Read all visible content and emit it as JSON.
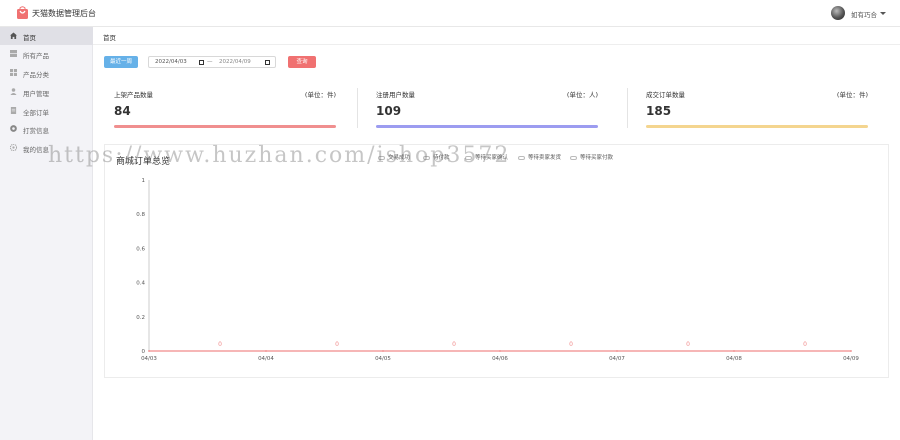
{
  "header": {
    "app_title": "天猫数据管理后台",
    "user_name": "如有巧合",
    "logo_icon": "shopping-bag-icon",
    "logo_color": "#f07171"
  },
  "sidebar": {
    "items": [
      {
        "label": "首页",
        "icon": "home-icon",
        "active": true
      },
      {
        "label": "所有产品",
        "icon": "grid-icon",
        "active": false
      },
      {
        "label": "产品分类",
        "icon": "category-icon",
        "active": false
      },
      {
        "label": "用户管理",
        "icon": "user-icon",
        "active": false
      },
      {
        "label": "全部订单",
        "icon": "order-icon",
        "active": false
      },
      {
        "label": "打赏信息",
        "icon": "reward-icon",
        "active": false
      },
      {
        "label": "我的信息",
        "icon": "settings-icon",
        "active": false
      }
    ]
  },
  "breadcrumb": "首页",
  "filters": {
    "last_week_label": "最近一周",
    "start_date": "2022/04/03",
    "separator": "—",
    "end_date": "2022/04/09",
    "query_label": "查询"
  },
  "stats": [
    {
      "title": "上架产品数量",
      "unit": "(单位：件)",
      "value": "84",
      "color": "#f08f8f"
    },
    {
      "title": "注册用户数量",
      "unit": "(单位：人)",
      "value": "109",
      "color": "#9c9cf0"
    },
    {
      "title": "成交订单数量",
      "unit": "(单位：件)",
      "value": "185",
      "color": "#f4d58f"
    }
  ],
  "chart_panel": {
    "title": "商城订单总览",
    "legend": [
      "交易成功",
      "待付款",
      "等待买家确认",
      "等待卖家发货",
      "等待买家付款"
    ]
  },
  "watermark": "https://www.huzhan.com/ishop3572",
  "chart_data": {
    "type": "line",
    "title": "商城订单总览",
    "categories": [
      "04/03",
      "04/04",
      "04/05",
      "04/06",
      "04/07",
      "04/08",
      "04/09"
    ],
    "series": [
      {
        "name": "交易成功",
        "values": [
          0,
          0,
          0,
          0,
          0,
          0,
          0
        ]
      },
      {
        "name": "待付款",
        "values": [
          0,
          0,
          0,
          0,
          0,
          0,
          0
        ]
      },
      {
        "name": "等待买家确认",
        "values": [
          0,
          0,
          0,
          0,
          0,
          0,
          0
        ]
      },
      {
        "name": "等待卖家发货",
        "values": [
          0,
          0,
          0,
          0,
          0,
          0,
          0
        ]
      },
      {
        "name": "等待买家付款",
        "values": [
          0,
          0,
          0,
          0,
          0,
          0,
          0
        ]
      }
    ],
    "point_labels": [
      "0",
      "0",
      "0",
      "0",
      "0",
      "0"
    ],
    "y_ticks": [
      "0",
      "0.2",
      "0.4",
      "0.6",
      "0.8",
      "1"
    ],
    "ylim": [
      0,
      1
    ],
    "grid": false,
    "legend_position": "top",
    "line_color": "#f08a8a"
  }
}
